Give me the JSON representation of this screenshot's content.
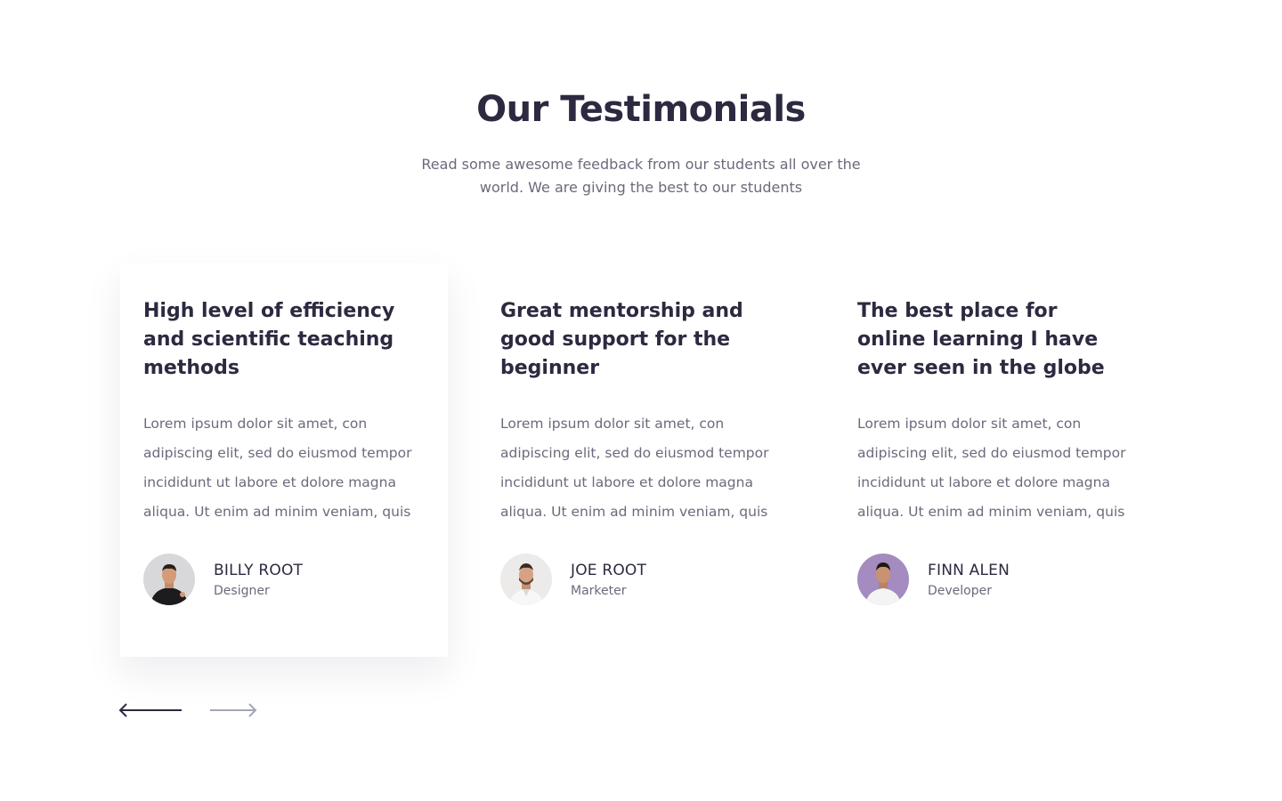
{
  "section": {
    "title": "Our Testimonials",
    "subtitle": "Read some awesome feedback from our students all over the world. We are giving the best to our students"
  },
  "testimonials": [
    {
      "title": "High level of efficiency and scientific teaching methods",
      "text": "Lorem ipsum dolor sit amet, con adipiscing elit, sed do eiusmod tempor incididunt ut labore et dolore magna aliqua. Ut enim ad minim veniam, quis",
      "name": "BILLY ROOT",
      "role": "Designer"
    },
    {
      "title": "Great mentorship and good support for the beginner",
      "text": "Lorem ipsum dolor sit amet, con adipiscing elit, sed do eiusmod tempor incididunt ut labore et dolore magna aliqua. Ut enim ad minim veniam, quis",
      "name": "JOE ROOT",
      "role": "Marketer"
    },
    {
      "title": "The best place for online learning I have ever seen in the globe",
      "text": "Lorem ipsum dolor sit amet, con adipiscing elit, sed do eiusmod tempor incididunt ut labore et dolore magna aliqua. Ut enim ad minim veniam, quis",
      "name": "FINN ALEN",
      "role": "Developer"
    }
  ],
  "navigation": {
    "prev_icon": "arrow-left-icon",
    "next_icon": "arrow-right-icon",
    "active_color": "#2b2a40",
    "inactive_color": "#a3a6b4"
  },
  "colors": {
    "heading": "#2b2a40",
    "body_text": "#6b6a7b"
  }
}
